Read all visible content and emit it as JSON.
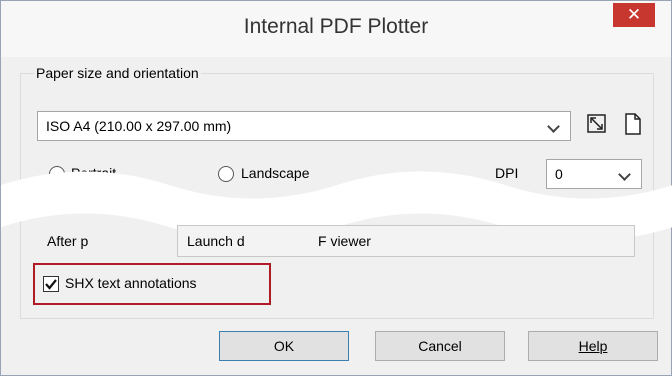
{
  "window": {
    "title": "Internal PDF Plotter",
    "close_glyph": "✕"
  },
  "paper": {
    "group_label": "Paper size and orientation",
    "size_value": "ISO A4 (210.00 x 297.00 mm)",
    "portrait_label": "Portrait",
    "landscape_label": "Landscape",
    "dpi_label": "DPI",
    "dpi_value": "0",
    "after_label": "After p",
    "after_value": "Launch d",
    "after_value_tail": "F viewer",
    "shx_label": "SHX text annotations",
    "shx_checked": true
  },
  "buttons": {
    "ok": "OK",
    "cancel": "Cancel",
    "help": "Help"
  },
  "colors": {
    "highlight": "#b01c26",
    "close": "#c7372f"
  }
}
